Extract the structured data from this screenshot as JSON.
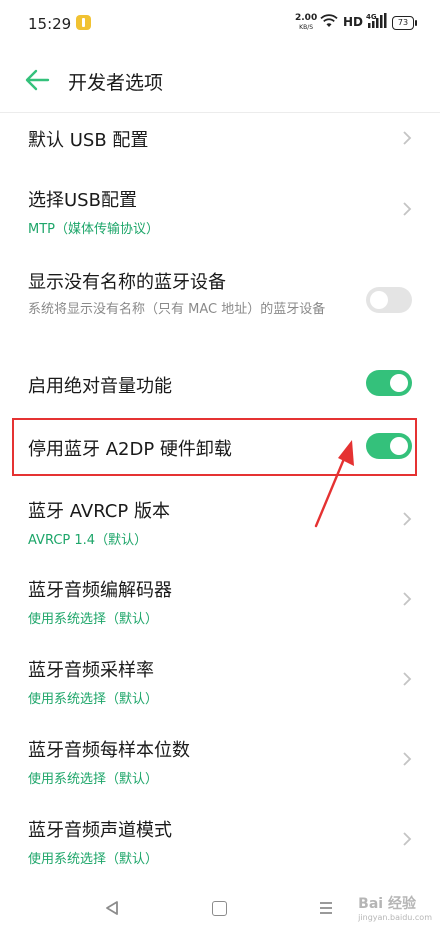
{
  "status_bar": {
    "time": "15:29",
    "net_speed": "2.00",
    "net_unit": "KB/S",
    "hd": "HD",
    "signal_label": "4G",
    "battery": "73"
  },
  "header": {
    "title": "开发者选项",
    "back_icon": "arrow-left-icon"
  },
  "colors": {
    "accent": "#34c17b",
    "subtitle_green": "#1ea66a",
    "highlight": "#e53232"
  },
  "items": [
    {
      "title": "默认 USB 配置",
      "control": "chevron"
    },
    {
      "title": "选择USB配置",
      "subtitle": "MTP（媒体传输协议）",
      "control": "chevron"
    },
    {
      "title": "显示没有名称的蓝牙设备",
      "subtitle": "系统将显示没有名称（只有 MAC 地址）的蓝牙设备",
      "control": "toggle",
      "toggle_on": false
    },
    {
      "title": "启用绝对音量功能",
      "control": "toggle",
      "toggle_on": true
    },
    {
      "title": "停用蓝牙 A2DP 硬件卸载",
      "control": "toggle",
      "toggle_on": true
    },
    {
      "title": "蓝牙 AVRCP 版本",
      "subtitle": "AVRCP 1.4（默认）",
      "control": "chevron"
    },
    {
      "title": "蓝牙音频编解码器",
      "subtitle": "使用系统选择（默认）",
      "control": "chevron"
    },
    {
      "title": "蓝牙音频采样率",
      "subtitle": "使用系统选择（默认）",
      "control": "chevron"
    },
    {
      "title": "蓝牙音频每样本位数",
      "subtitle": "使用系统选择（默认）",
      "control": "chevron"
    },
    {
      "title": "蓝牙音频声道模式",
      "subtitle": "使用系统选择（默认）",
      "control": "chevron"
    }
  ],
  "watermark": {
    "text": "Bai 经验",
    "sub": "jingyan.baidu.com"
  }
}
